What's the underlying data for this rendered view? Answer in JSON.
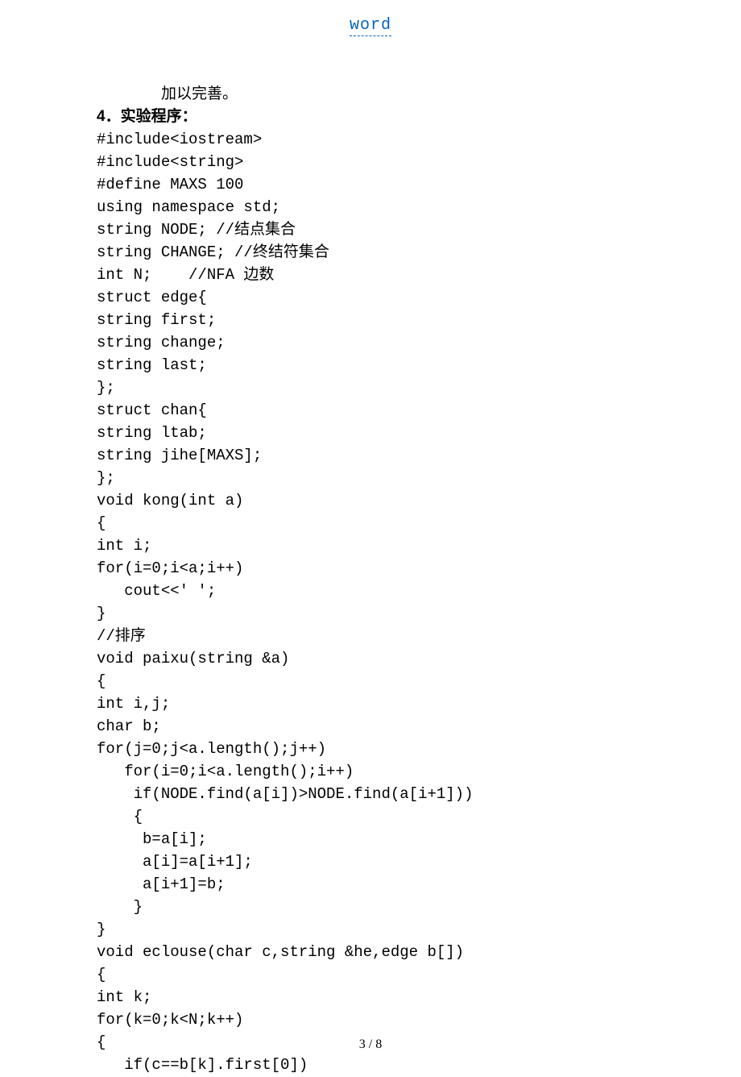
{
  "header": {
    "link_text": "word"
  },
  "intro_line": "加以完善。",
  "section_title": "4．实验程序：",
  "code_lines": [
    "#include<iostream>",
    "#include<string>",
    "#define MAXS 100",
    "using namespace std;",
    "string NODE; //结点集合",
    "string CHANGE; //终结符集合",
    "int N;    //NFA 边数",
    "struct edge{",
    "string first;",
    "string change;",
    "string last;",
    "};",
    "struct chan{",
    "string ltab;",
    "string jihe[MAXS];",
    "};",
    "void kong(int a)",
    "{",
    "int i;",
    "for(i=0;i<a;i++)",
    "   cout<<' ';",
    "}",
    "//排序",
    "void paixu(string &a)",
    "{",
    "int i,j;",
    "char b;",
    "for(j=0;j<a.length();j++)",
    "   for(i=0;i<a.length();i++)",
    "    if(NODE.find(a[i])>NODE.find(a[i+1]))",
    "    {",
    "     b=a[i];",
    "     a[i]=a[i+1];",
    "     a[i+1]=b;",
    "    }",
    "}",
    "void eclouse(char c,string &he,edge b[])",
    "{",
    "int k;",
    "for(k=0;k<N;k++)",
    "{",
    "   if(c==b[k].first[0])"
  ],
  "footer": {
    "page_text": "3 / 8"
  }
}
